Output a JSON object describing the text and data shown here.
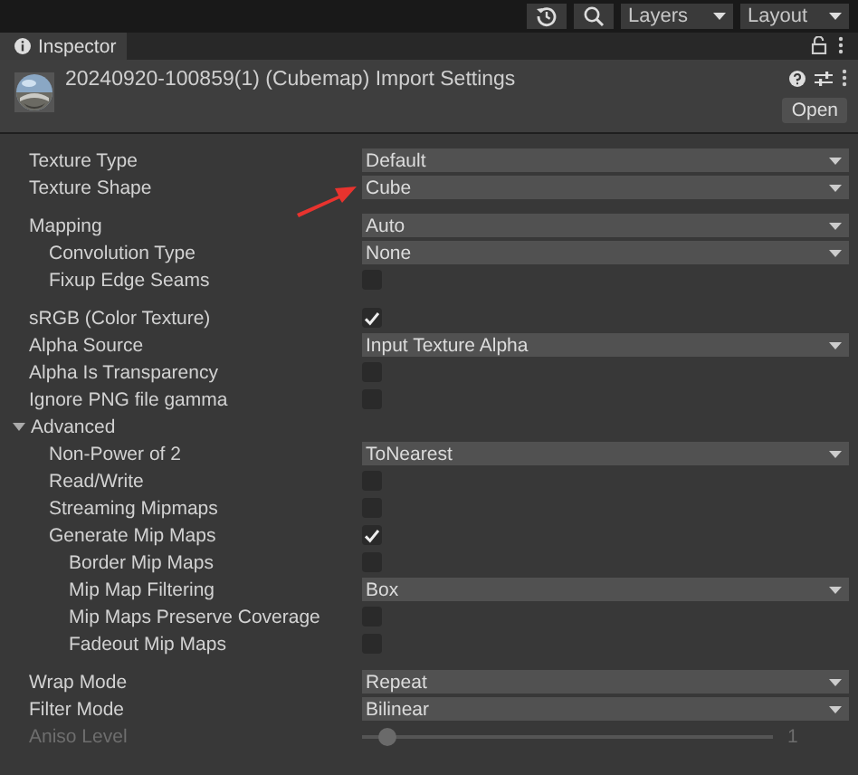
{
  "toolbar": {
    "layers": "Layers",
    "layout": "Layout"
  },
  "tab": {
    "label": "Inspector",
    "selected": true
  },
  "header": {
    "title": "20240920-100859(1) (Cubemap) Import Settings",
    "open_button": "Open"
  },
  "groups": [
    [
      {
        "kind": "dropdown",
        "label": "Texture Type",
        "value": "Default"
      },
      {
        "kind": "dropdown",
        "label": "Texture Shape",
        "value": "Cube",
        "annotated": true
      }
    ],
    [
      {
        "kind": "dropdown",
        "label": "Mapping",
        "value": "Auto",
        "children": [
          {
            "kind": "dropdown",
            "label": "Convolution Type",
            "value": "None"
          },
          {
            "kind": "checkbox",
            "label": "Fixup Edge Seams",
            "checked": false
          }
        ]
      }
    ],
    [
      {
        "kind": "checkbox",
        "label": "sRGB (Color Texture)",
        "checked": true
      },
      {
        "kind": "dropdown",
        "label": "Alpha Source",
        "value": "Input Texture Alpha"
      },
      {
        "kind": "checkbox",
        "label": "Alpha Is Transparency",
        "checked": false
      },
      {
        "kind": "checkbox",
        "label": "Ignore PNG file gamma",
        "checked": false
      },
      {
        "kind": "foldout",
        "label": "Advanced",
        "expanded": true,
        "children": [
          {
            "kind": "dropdown",
            "label": "Non-Power of 2",
            "value": "ToNearest"
          },
          {
            "kind": "checkbox",
            "label": "Read/Write",
            "checked": false
          },
          {
            "kind": "checkbox",
            "label": "Streaming Mipmaps",
            "checked": false
          },
          {
            "kind": "checkbox",
            "label": "Generate Mip Maps",
            "checked": true,
            "children": [
              {
                "kind": "checkbox",
                "label": "Border Mip Maps",
                "checked": false
              },
              {
                "kind": "dropdown",
                "label": "Mip Map Filtering",
                "value": "Box"
              },
              {
                "kind": "checkbox",
                "label": "Mip Maps Preserve Coverage",
                "checked": false
              },
              {
                "kind": "checkbox",
                "label": "Fadeout Mip Maps",
                "checked": false
              }
            ]
          }
        ]
      }
    ],
    [
      {
        "kind": "dropdown",
        "label": "Wrap Mode",
        "value": "Repeat"
      },
      {
        "kind": "dropdown",
        "label": "Filter Mode",
        "value": "Bilinear"
      },
      {
        "kind": "slider",
        "label": "Aniso Level",
        "level": 0.06,
        "reading": "1",
        "disabled": true
      }
    ]
  ]
}
